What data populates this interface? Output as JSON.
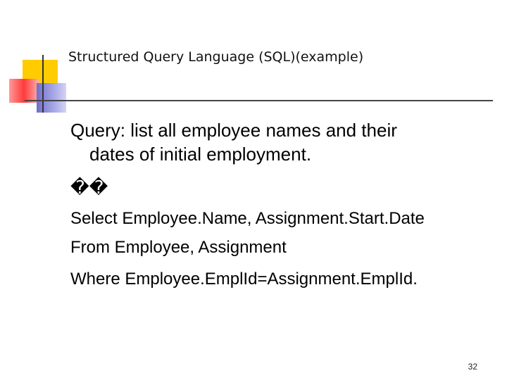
{
  "slide": {
    "title": "Structured Query Language (SQL)(example)",
    "query_line1": "Query: list all employee names and their",
    "query_line2": "dates of initial employment.",
    "glyphs": "��",
    "sql_select": "Select Employee.Name, Assignment.Start.Date",
    "sql_from": "From Employee, Assignment",
    "sql_where": "Where Employee.EmplId=Assignment.EmplId.",
    "page_number": "32"
  },
  "colors": {
    "accent_yellow": "#ffcc00",
    "accent_red": "#ff3b3b",
    "accent_blue": "#6f6fcc"
  }
}
